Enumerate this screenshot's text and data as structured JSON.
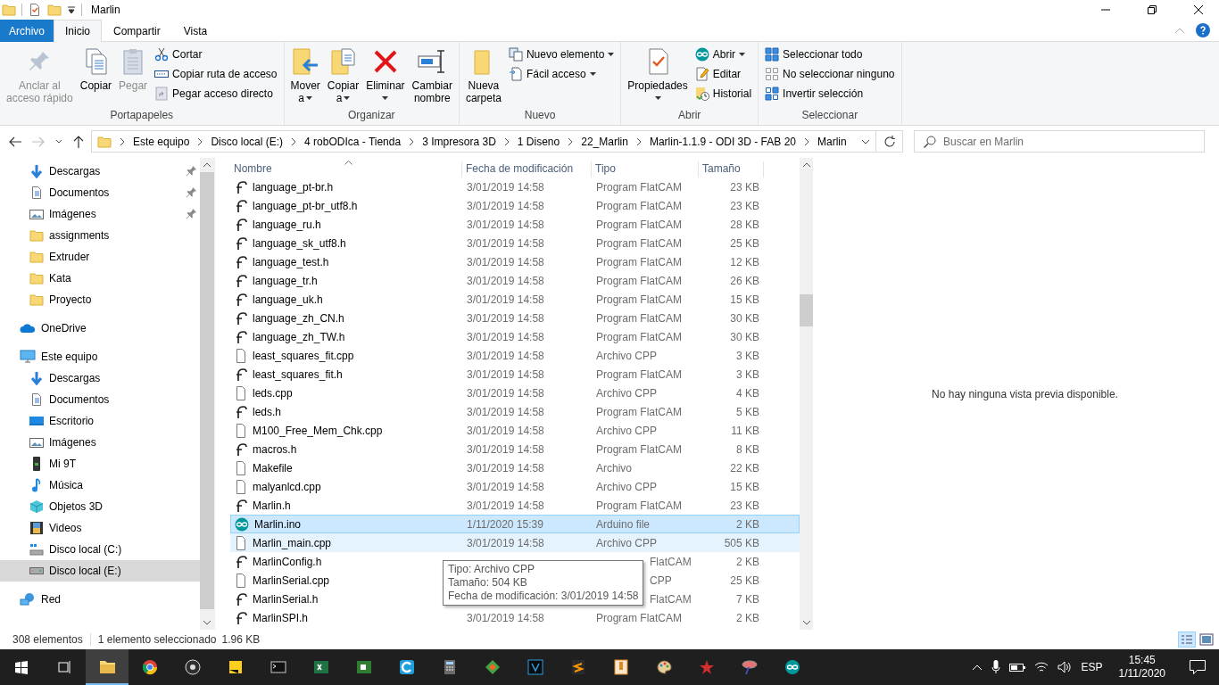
{
  "window": {
    "title": "Marlin"
  },
  "ribbon": {
    "tabs": [
      {
        "label": "Archivo",
        "kind": "file_menu",
        "selected": false
      },
      {
        "label": "Inicio",
        "kind": "tab",
        "selected": true
      },
      {
        "label": "Compartir",
        "kind": "tab",
        "selected": false
      },
      {
        "label": "Vista",
        "kind": "tab",
        "selected": false
      }
    ],
    "groups": [
      {
        "label": "Portapapeles",
        "items": [
          {
            "label": "Anclar al\nacceso rápido",
            "kind": "large",
            "disabled": true,
            "has_menu": false
          },
          {
            "label": "Copiar",
            "kind": "large",
            "disabled": false,
            "has_menu": false
          },
          {
            "label": "Pegar",
            "kind": "large",
            "disabled": true,
            "has_menu": false
          },
          {
            "label": "Cortar",
            "kind": "small",
            "disabled": false,
            "has_menu": false
          },
          {
            "label": "Copiar ruta de acceso",
            "kind": "small",
            "disabled": false,
            "has_menu": false
          },
          {
            "label": "Pegar acceso directo",
            "kind": "small",
            "disabled": true,
            "has_menu": false
          }
        ]
      },
      {
        "label": "Organizar",
        "items": [
          {
            "label": "Mover\na",
            "kind": "large",
            "disabled": false,
            "has_menu": true
          },
          {
            "label": "Copiar\na",
            "kind": "large",
            "disabled": false,
            "has_menu": true
          },
          {
            "label": "Eliminar",
            "kind": "large",
            "disabled": false,
            "has_menu": true
          },
          {
            "label": "Cambiar\nnombre",
            "kind": "large",
            "disabled": false,
            "has_menu": false
          }
        ]
      },
      {
        "label": "Nuevo",
        "items": [
          {
            "label": "Nueva\ncarpeta",
            "kind": "large",
            "disabled": false,
            "has_menu": false
          },
          {
            "label": "Nuevo elemento",
            "kind": "small",
            "disabled": false,
            "has_menu": true
          },
          {
            "label": "Fácil acceso",
            "kind": "small",
            "disabled": false,
            "has_menu": true
          }
        ]
      },
      {
        "label": "Abrir",
        "items": [
          {
            "label": "Propiedades",
            "kind": "large",
            "disabled": false,
            "has_menu": true
          },
          {
            "label": "Abrir",
            "kind": "small",
            "disabled": false,
            "has_menu": true
          },
          {
            "label": "Editar",
            "kind": "small",
            "disabled": false,
            "has_menu": false
          },
          {
            "label": "Historial",
            "kind": "small",
            "disabled": false,
            "has_menu": false
          }
        ]
      },
      {
        "label": "Seleccionar",
        "items": [
          {
            "label": "Seleccionar todo",
            "kind": "small",
            "disabled": false,
            "has_menu": false
          },
          {
            "label": "No seleccionar ninguno",
            "kind": "small",
            "disabled": false,
            "has_menu": false
          },
          {
            "label": "Invertir selección",
            "kind": "small",
            "disabled": false,
            "has_menu": false
          }
        ]
      }
    ]
  },
  "address_bar": {
    "path": [
      "Este equipo",
      "Disco local (E:)",
      "4 robODIca - Tienda",
      "3 Impresora 3D",
      "1 Diseno",
      "22_Marlin",
      "Marlin-1.1.9 - ODI 3D - FAB 20",
      "Marlin"
    ]
  },
  "search": {
    "placeholder": "Buscar en Marlin"
  },
  "navigation": {
    "quick_access": [
      {
        "label": "Descargas",
        "pinned": true,
        "selected": false
      },
      {
        "label": "Documentos",
        "pinned": true,
        "selected": false
      },
      {
        "label": "Imágenes",
        "pinned": true,
        "selected": false
      },
      {
        "label": "assignments",
        "pinned": false,
        "selected": false
      },
      {
        "label": "Extruder",
        "pinned": false,
        "selected": false
      },
      {
        "label": "Kata",
        "pinned": false,
        "selected": false
      },
      {
        "label": "Proyecto",
        "pinned": false,
        "selected": false
      }
    ],
    "locations": [
      {
        "label": "OneDrive",
        "selected": false
      },
      {
        "label": "Este equipo",
        "selected": false,
        "children": [
          {
            "label": "Descargas",
            "selected": false
          },
          {
            "label": "Documentos",
            "selected": false
          },
          {
            "label": "Escritorio",
            "selected": false
          },
          {
            "label": "Imágenes",
            "selected": false
          },
          {
            "label": "Mi 9T",
            "selected": false
          },
          {
            "label": "Música",
            "selected": false
          },
          {
            "label": "Objetos 3D",
            "selected": false
          },
          {
            "label": "Videos",
            "selected": false
          },
          {
            "label": "Disco local (C:)",
            "selected": false
          },
          {
            "label": "Disco local (E:)",
            "selected": true
          }
        ]
      },
      {
        "label": "Red",
        "selected": false
      }
    ]
  },
  "file_list": {
    "columns": [
      "Nombre",
      "Fecha de modificación",
      "Tipo",
      "Tamaño"
    ],
    "rows": [
      {
        "name": "language_pt-br.h",
        "date": "3/01/2019 14:58",
        "type": "Program FlatCAM",
        "size": "23 KB",
        "kind": "flatcam",
        "selected": false,
        "hovered": false,
        "covered": false
      },
      {
        "name": "language_pt-br_utf8.h",
        "date": "3/01/2019 14:58",
        "type": "Program FlatCAM",
        "size": "23 KB",
        "kind": "flatcam",
        "selected": false,
        "hovered": false,
        "covered": false
      },
      {
        "name": "language_ru.h",
        "date": "3/01/2019 14:58",
        "type": "Program FlatCAM",
        "size": "28 KB",
        "kind": "flatcam",
        "selected": false,
        "hovered": false,
        "covered": false
      },
      {
        "name": "language_sk_utf8.h",
        "date": "3/01/2019 14:58",
        "type": "Program FlatCAM",
        "size": "25 KB",
        "kind": "flatcam",
        "selected": false,
        "hovered": false,
        "covered": false
      },
      {
        "name": "language_test.h",
        "date": "3/01/2019 14:58",
        "type": "Program FlatCAM",
        "size": "12 KB",
        "kind": "flatcam",
        "selected": false,
        "hovered": false,
        "covered": false
      },
      {
        "name": "language_tr.h",
        "date": "3/01/2019 14:58",
        "type": "Program FlatCAM",
        "size": "26 KB",
        "kind": "flatcam",
        "selected": false,
        "hovered": false,
        "covered": false
      },
      {
        "name": "language_uk.h",
        "date": "3/01/2019 14:58",
        "type": "Program FlatCAM",
        "size": "15 KB",
        "kind": "flatcam",
        "selected": false,
        "hovered": false,
        "covered": false
      },
      {
        "name": "language_zh_CN.h",
        "date": "3/01/2019 14:58",
        "type": "Program FlatCAM",
        "size": "30 KB",
        "kind": "flatcam",
        "selected": false,
        "hovered": false,
        "covered": false
      },
      {
        "name": "language_zh_TW.h",
        "date": "3/01/2019 14:58",
        "type": "Program FlatCAM",
        "size": "30 KB",
        "kind": "flatcam",
        "selected": false,
        "hovered": false,
        "covered": false
      },
      {
        "name": "least_squares_fit.cpp",
        "date": "3/01/2019 14:58",
        "type": "Archivo CPP",
        "size": "3 KB",
        "kind": "document",
        "selected": false,
        "hovered": false,
        "covered": false
      },
      {
        "name": "least_squares_fit.h",
        "date": "3/01/2019 14:58",
        "type": "Program FlatCAM",
        "size": "3 KB",
        "kind": "flatcam",
        "selected": false,
        "hovered": false,
        "covered": false
      },
      {
        "name": "leds.cpp",
        "date": "3/01/2019 14:58",
        "type": "Archivo CPP",
        "size": "4 KB",
        "kind": "document",
        "selected": false,
        "hovered": false,
        "covered": false
      },
      {
        "name": "leds.h",
        "date": "3/01/2019 14:58",
        "type": "Program FlatCAM",
        "size": "5 KB",
        "kind": "flatcam",
        "selected": false,
        "hovered": false,
        "covered": false
      },
      {
        "name": "M100_Free_Mem_Chk.cpp",
        "date": "3/01/2019 14:58",
        "type": "Archivo CPP",
        "size": "11 KB",
        "kind": "document",
        "selected": false,
        "hovered": false,
        "covered": false
      },
      {
        "name": "macros.h",
        "date": "3/01/2019 14:58",
        "type": "Program FlatCAM",
        "size": "8 KB",
        "kind": "flatcam",
        "selected": false,
        "hovered": false,
        "covered": false
      },
      {
        "name": "Makefile",
        "date": "3/01/2019 14:58",
        "type": "Archivo",
        "size": "22 KB",
        "kind": "document",
        "selected": false,
        "hovered": false,
        "covered": false
      },
      {
        "name": "malyanlcd.cpp",
        "date": "3/01/2019 14:58",
        "type": "Archivo CPP",
        "size": "15 KB",
        "kind": "document",
        "selected": false,
        "hovered": false,
        "covered": false
      },
      {
        "name": "Marlin.h",
        "date": "3/01/2019 14:58",
        "type": "Program FlatCAM",
        "size": "23 KB",
        "kind": "flatcam",
        "selected": false,
        "hovered": false,
        "covered": false
      },
      {
        "name": "Marlin.ino",
        "date": "1/11/2020 15:39",
        "type": "Arduino file",
        "size": "2 KB",
        "kind": "arduino",
        "selected": true,
        "hovered": false,
        "covered": false
      },
      {
        "name": "Marlin_main.cpp",
        "date": "3/01/2019 14:58",
        "type": "Archivo CPP",
        "size": "505 KB",
        "kind": "document",
        "selected": false,
        "hovered": true,
        "covered": false
      },
      {
        "name": "MarlinConfig.h",
        "type": "FlatCAM",
        "size": "2 KB",
        "kind": "flatcam",
        "selected": false,
        "hovered": false,
        "covered": true
      },
      {
        "name": "MarlinSerial.cpp",
        "type": "CPP",
        "size": "25 KB",
        "kind": "document",
        "selected": false,
        "hovered": false,
        "covered": true
      },
      {
        "name": "MarlinSerial.h",
        "type": "FlatCAM",
        "size": "7 KB",
        "kind": "flatcam",
        "selected": false,
        "hovered": false,
        "covered": true
      },
      {
        "name": "MarlinSPI.h",
        "date": "3/01/2019 14:58",
        "type": "Program FlatCAM",
        "size": "2 KB",
        "kind": "flatcam",
        "selected": false,
        "hovered": false,
        "covered": false
      }
    ],
    "tooltip": [
      "Tipo: Archivo CPP",
      "Tamaño: 504 KB",
      "Fecha de modificación: 3/01/2019 14:58"
    ]
  },
  "preview": {
    "message": "No hay ninguna vista previa disponible."
  },
  "status_bar": {
    "item_count": "308 elementos",
    "selection": "1 elemento seleccionado",
    "selection_size": "1.96 KB"
  },
  "taskbar": {
    "language": "ESP",
    "time": "15:45",
    "date": "1/11/2020"
  }
}
